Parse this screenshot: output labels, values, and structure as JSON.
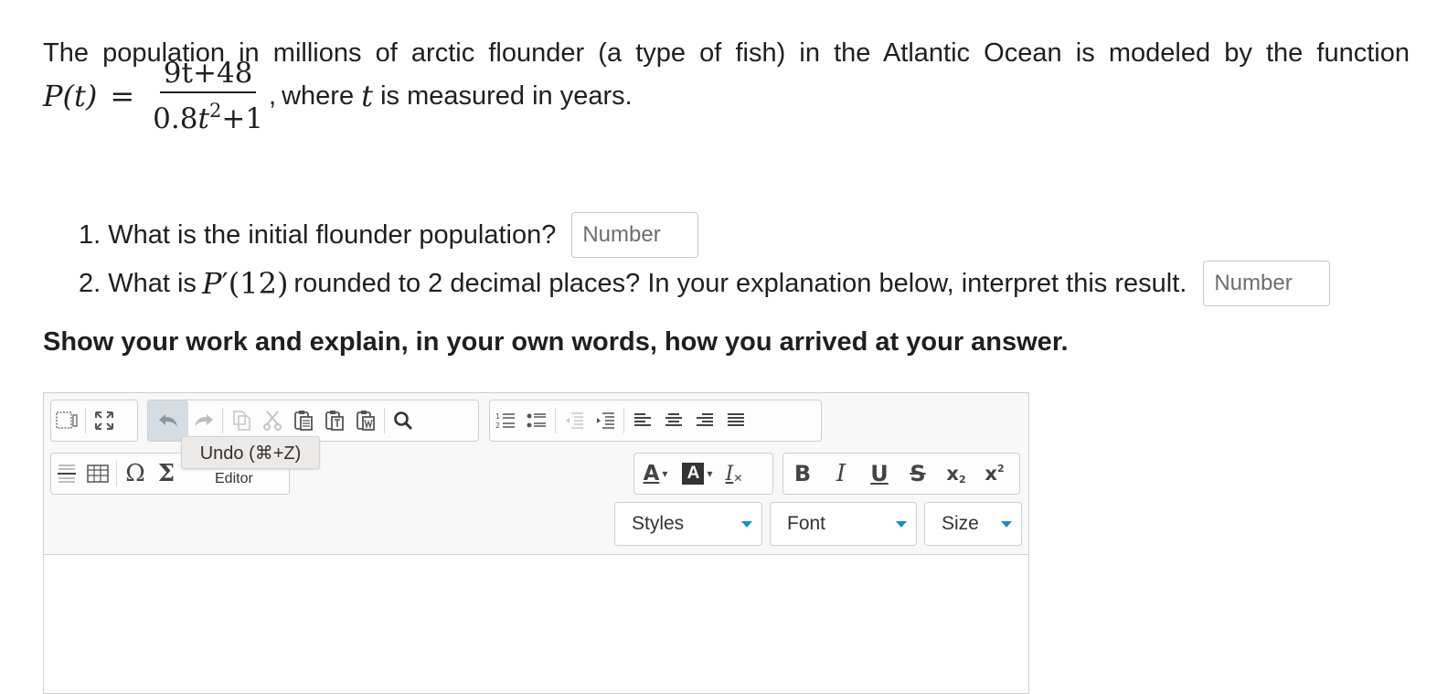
{
  "problem": {
    "intro_text": "The population in millions of arctic flounder (a type of fish) in the Atlantic Ocean is modeled by the function",
    "function_lhs": "P(t)",
    "equals": "=",
    "numerator": "9t+48",
    "denominator_coef": "0.8",
    "denominator_var": "t",
    "denominator_exp": "2",
    "denominator_tail": "+1",
    "comma": ",",
    "where_prefix": "where",
    "where_var": "t",
    "where_suffix": "is measured in years."
  },
  "questions": [
    {
      "number": "1.",
      "text": "What is the initial flounder population?",
      "placeholder": "Number"
    },
    {
      "number": "2.",
      "text_before": "What is",
      "math_func": "P",
      "math_prime": "′",
      "math_arg": "(12)",
      "text_after": "rounded to 2 decimal places? In your explanation below, interpret this result.",
      "placeholder": "Number"
    }
  ],
  "instruction": "Show your work and explain, in your own words, how you arrived at your answer.",
  "editor": {
    "tooltip": "Undo (⌘+Z)",
    "caption": "Editor",
    "dropdowns": [
      {
        "label": "Styles"
      },
      {
        "label": "Font"
      },
      {
        "label": "Size"
      }
    ],
    "format_labels": {
      "text_color": "A",
      "bg_color": "A",
      "remove_format": "I",
      "bold": "B",
      "italic": "I",
      "underline": "U",
      "strike": "S",
      "subscript": "x",
      "superscript": "x",
      "omega": "Ω",
      "sigma": "Σ"
    }
  }
}
